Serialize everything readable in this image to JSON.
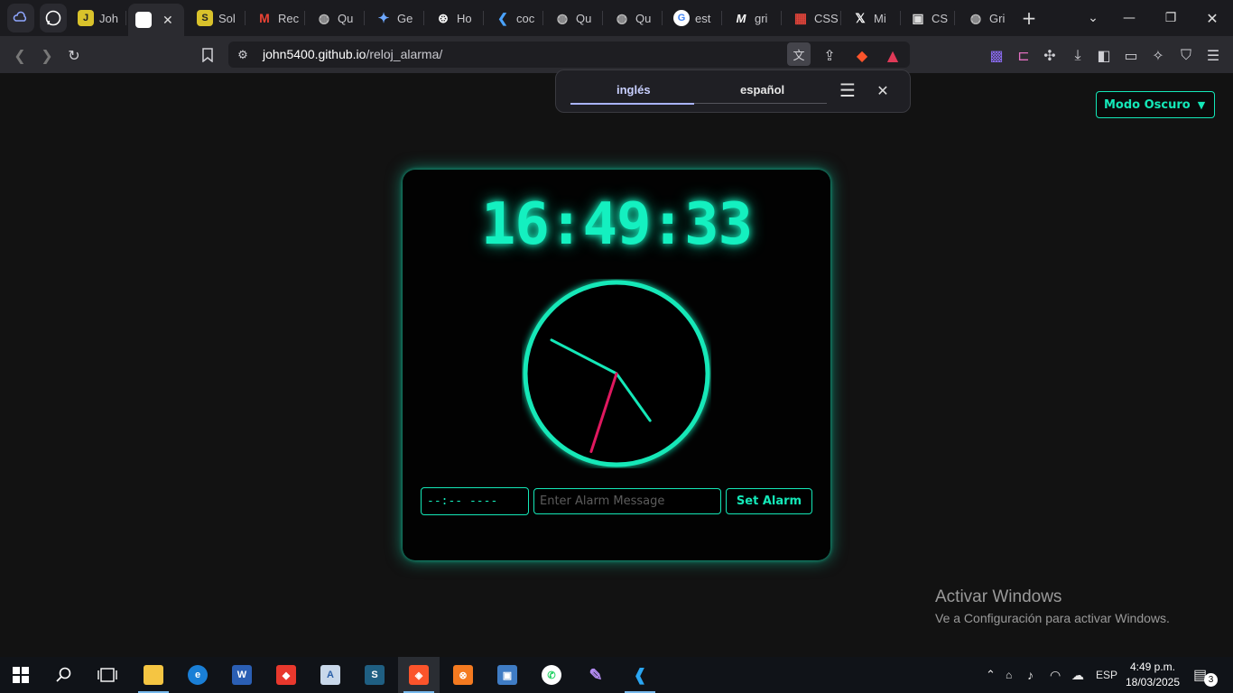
{
  "browser": {
    "tabs": [
      {
        "name": "tab-pinned-1",
        "label": ""
      },
      {
        "name": "tab-whatsapp",
        "label": ""
      },
      {
        "name": "tab-john",
        "label": "Joh"
      },
      {
        "name": "tab-active",
        "label": ""
      },
      {
        "name": "tab-sol",
        "label": "Sol"
      },
      {
        "name": "tab-gmail",
        "label": "Rec"
      },
      {
        "name": "tab-qu-1",
        "label": "Qu"
      },
      {
        "name": "tab-gemini",
        "label": "Ge"
      },
      {
        "name": "tab-chatgpt",
        "label": "Ho"
      },
      {
        "name": "tab-codepen",
        "label": "coc"
      },
      {
        "name": "tab-qu-2",
        "label": "Qu"
      },
      {
        "name": "tab-qu-3",
        "label": "Qu"
      },
      {
        "name": "tab-google",
        "label": "est"
      },
      {
        "name": "tab-medium",
        "label": "gri"
      },
      {
        "name": "tab-css-grid",
        "label": "CSS"
      },
      {
        "name": "tab-x",
        "label": "Mi"
      },
      {
        "name": "tab-css-2",
        "label": "CS"
      },
      {
        "name": "tab-gri",
        "label": "Gri"
      }
    ],
    "url": {
      "host": "john5400.github.io",
      "path": "/reloj_alarma/"
    }
  },
  "translate": {
    "tab_source": "inglés",
    "tab_target": "español"
  },
  "page": {
    "mode_select": "Modo Oscuro",
    "digital_time": "16:49:33",
    "alarm_time_value": "--:-- ----",
    "alarm_message_placeholder": "Enter Alarm Message",
    "set_alarm_label": "Set Alarm"
  },
  "analog_clock": {
    "hours": 16,
    "minutes": 49,
    "seconds": 33
  },
  "watermark": {
    "line1": "Activar Windows",
    "line2": "Ve a Configuración para activar Windows."
  },
  "taskbar": {
    "lang": "ESP",
    "time": "4:49 p.m.",
    "date": "18/03/2025",
    "notifications": "3"
  },
  "colors": {
    "accent": "#14e8b8",
    "second_hand": "#e0185f",
    "page_bg": "#121212"
  }
}
